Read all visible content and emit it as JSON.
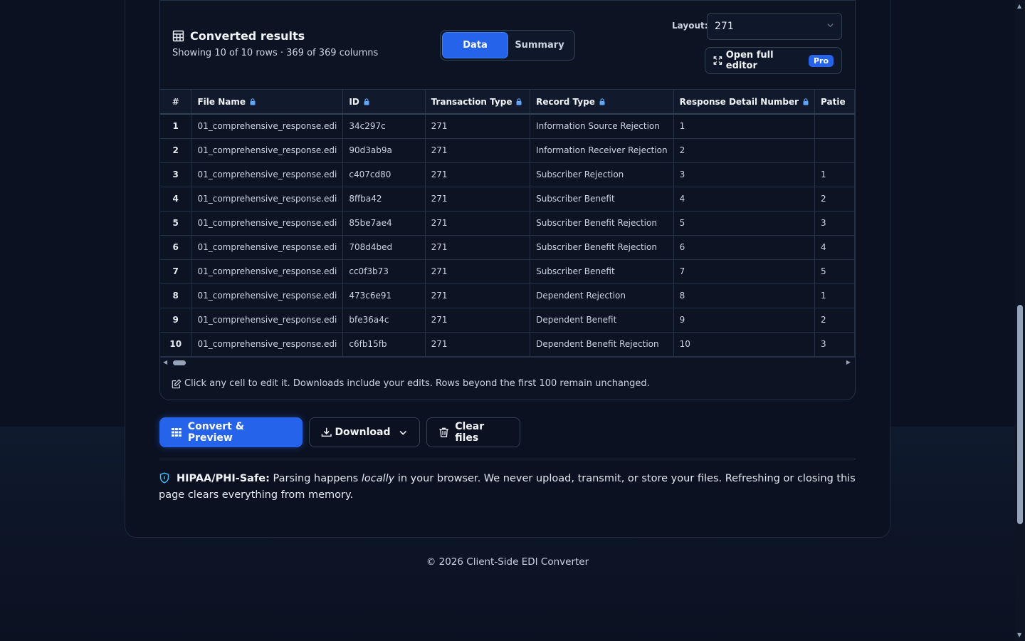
{
  "results": {
    "title": "Converted results",
    "subtitle": "Showing 10 of 10 rows · 369 of 369 columns",
    "tabs": [
      {
        "label": "Data"
      },
      {
        "label": "Summary"
      }
    ],
    "layout_label": "Layout:",
    "layout_value": "271",
    "open_editor_label": "Open full editor",
    "pro_badge": "Pro"
  },
  "table": {
    "headers": [
      "#",
      "File Name",
      "ID",
      "Transaction Type",
      "Record Type",
      "Response Detail Number",
      "Patie"
    ],
    "rows": [
      [
        "1",
        "01_comprehensive_response.edi",
        "34c297c",
        "271",
        "Information Source Rejection",
        "1",
        ""
      ],
      [
        "2",
        "01_comprehensive_response.edi",
        "90d3ab9a",
        "271",
        "Information Receiver Rejection",
        "2",
        ""
      ],
      [
        "3",
        "01_comprehensive_response.edi",
        "c407cd80",
        "271",
        "Subscriber Rejection",
        "3",
        "1"
      ],
      [
        "4",
        "01_comprehensive_response.edi",
        "8ffba42",
        "271",
        "Subscriber Benefit",
        "4",
        "2"
      ],
      [
        "5",
        "01_comprehensive_response.edi",
        "85be7ae4",
        "271",
        "Subscriber Benefit Rejection",
        "5",
        "3"
      ],
      [
        "6",
        "01_comprehensive_response.edi",
        "708d4bed",
        "271",
        "Subscriber Benefit Rejection",
        "6",
        "4"
      ],
      [
        "7",
        "01_comprehensive_response.edi",
        "cc0f3b73",
        "271",
        "Subscriber Benefit",
        "7",
        "5"
      ],
      [
        "8",
        "01_comprehensive_response.edi",
        "473c6e91",
        "271",
        "Dependent Rejection",
        "8",
        "1"
      ],
      [
        "9",
        "01_comprehensive_response.edi",
        "bfe36a4c",
        "271",
        "Dependent Benefit",
        "9",
        "2"
      ],
      [
        "10",
        "01_comprehensive_response.edi",
        "c6fb15fb",
        "271",
        "Dependent Benefit Rejection",
        "10",
        "3"
      ]
    ]
  },
  "edit_note": "Click any cell to edit it. Downloads include your edits. Rows beyond the first 100 remain unchanged.",
  "actions": {
    "convert_label": "Convert & Preview",
    "download_label": "Download",
    "clear_label": "Clear files"
  },
  "hipaa": {
    "bold": "HIPAA/PHI-Safe:",
    "text_before": " Parsing happens ",
    "emphasis": "locally",
    "text_after": " in your browser. We never upload, transmit, or store your files. Refreshing or closing this page clears everything from memory."
  },
  "footer": "© 2026 Client-Side EDI Converter",
  "colors": {
    "accent": "#2563eb",
    "background": "#0b1121",
    "border": "#263247"
  }
}
